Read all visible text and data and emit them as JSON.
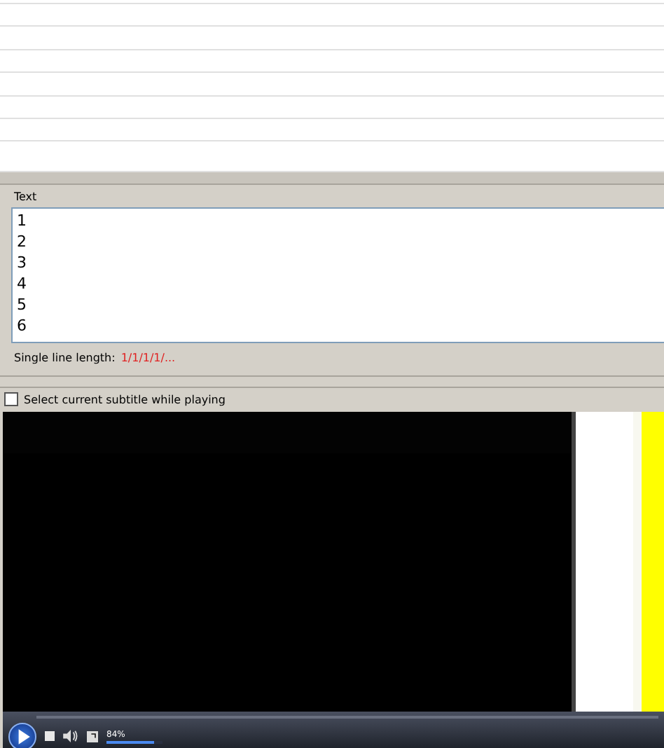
{
  "text_panel": {
    "label": "Text",
    "lines": [
      "1",
      "2",
      "3",
      "4",
      "5",
      "6"
    ]
  },
  "single_line_length": {
    "label": "Single line length:",
    "value": "1/1/1/1/..."
  },
  "select_while_playing": {
    "label": "Select current subtitle while playing",
    "checked": false
  },
  "player": {
    "volume": {
      "reading": "84%",
      "level": 0.84
    }
  }
}
